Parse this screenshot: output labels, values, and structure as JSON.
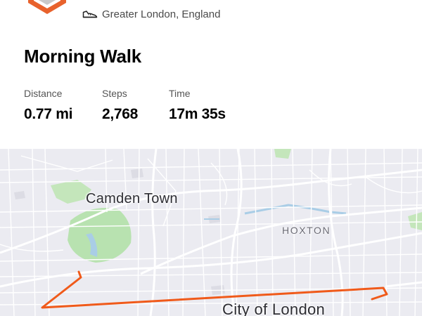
{
  "activity": {
    "location": "Greater London, England",
    "title": "Morning Walk"
  },
  "stats": [
    {
      "label": "Distance",
      "value": "0.77 mi"
    },
    {
      "label": "Steps",
      "value": "2,768"
    },
    {
      "label": "Time",
      "value": "17m 35s"
    }
  ],
  "map": {
    "places": {
      "camden": "Camden Town",
      "hoxton": "HOXTON",
      "city": "City of London"
    },
    "colors": {
      "route": "#f05a1a",
      "park": "#b8e2b0",
      "water": "#a9cde6",
      "background": "#ebebf1"
    }
  },
  "icons": {
    "badge": "activity-badge-icon",
    "sport": "walking-shoe-icon"
  }
}
